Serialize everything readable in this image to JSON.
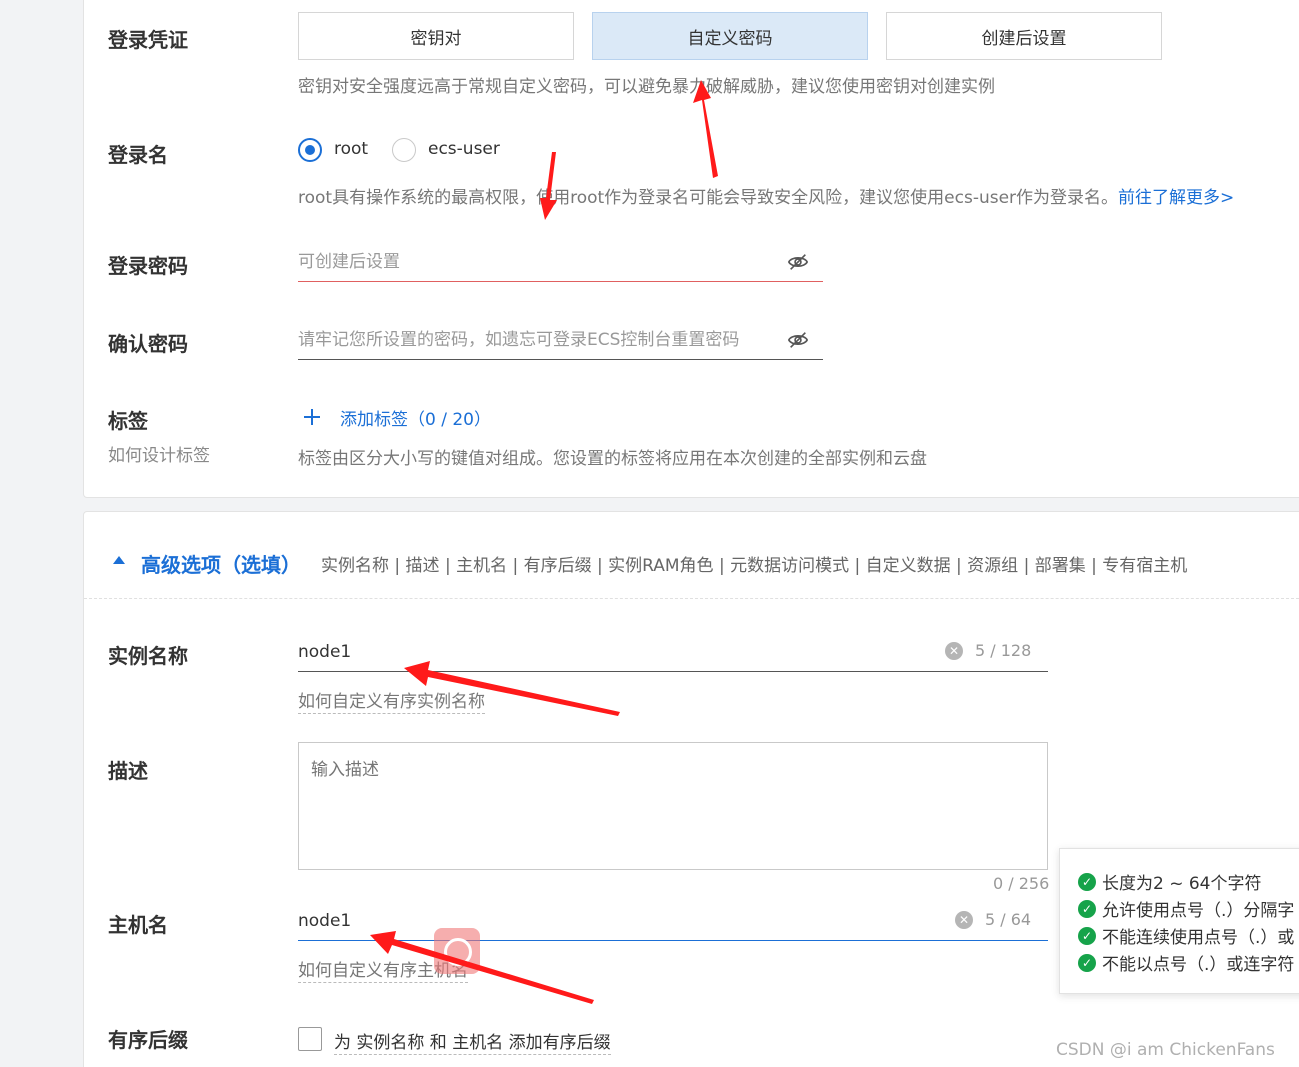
{
  "login_credentials": {
    "label": "登录凭证",
    "options": [
      "密钥对",
      "自定义密码",
      "创建后设置"
    ],
    "selected": "自定义密码",
    "help": "密钥对安全强度远高于常规自定义密码，可以避免暴力破解威胁，建议您使用密钥对创建实例"
  },
  "login_name": {
    "label": "登录名",
    "options": [
      "root",
      "ecs-user"
    ],
    "selected": "root",
    "help": "root具有操作系统的最高权限，使用root作为登录名可能会导致安全风险，建议您使用ecs-user作为登录名。",
    "link": "前往了解更多>"
  },
  "login_password": {
    "label": "登录密码",
    "placeholder": "可创建后设置"
  },
  "confirm_password": {
    "label": "确认密码",
    "placeholder": "请牢记您所设置的密码，如遗忘可登录ECS控制台重置密码"
  },
  "tags": {
    "label": "标签",
    "sub_label": "如何设计标签",
    "add_label": "添加标签（0 / 20）",
    "help": "标签由区分大小写的键值对组成。您设置的标签将应用在本次创建的全部实例和云盘"
  },
  "advanced": {
    "title": "高级选项（选填）",
    "summary": "实例名称 | 描述 | 主机名 | 有序后缀 | 实例RAM角色 | 元数据访问模式 | 自定义数据 | 资源组 | 部署集 | 专有宿主机",
    "instance_name": {
      "label": "实例名称",
      "value": "node1",
      "counter": "5 / 128",
      "help_link": "如何自定义有序实例名称"
    },
    "description": {
      "label": "描述",
      "placeholder": "输入描述",
      "counter": "0 / 256"
    },
    "hostname": {
      "label": "主机名",
      "value": "node1",
      "counter": "5 / 64",
      "help_link": "如何自定义有序主机名"
    },
    "ordered_suffix": {
      "label": "有序后缀",
      "checkbox_text": "为 实例名称 和 主机名 添加有序后缀",
      "checked": false
    }
  },
  "hostname_rules": [
    "长度为2 ~ 64个字符",
    "允许使用点号（.）分隔字",
    "不能连续使用点号（.）或",
    "不能以点号（.）或连字符"
  ],
  "watermark": "CSDN @i am ChickenFans",
  "colors": {
    "accent": "#1b6fd6",
    "selected_bg": "#dbe9f7",
    "arrow": "#ff1a1a",
    "check": "#16a34a"
  }
}
